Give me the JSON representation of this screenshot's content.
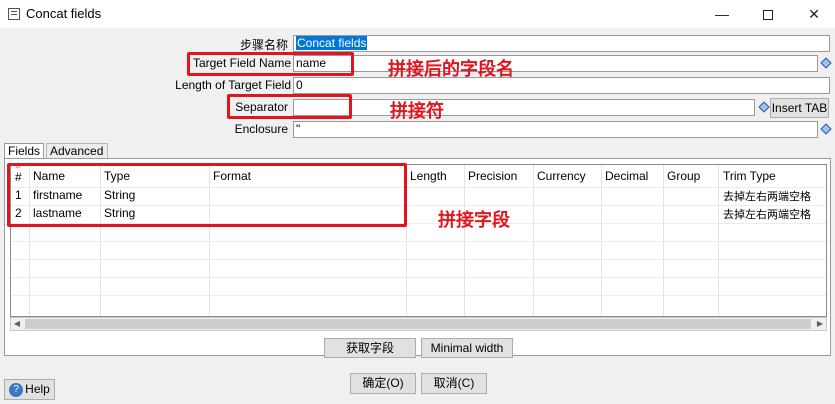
{
  "window": {
    "title": "Concat fields",
    "minimize": "—",
    "close": "✕"
  },
  "form": {
    "step_name_label": "步骤名称",
    "step_name_value": "Concat fields",
    "target_field_label": "Target Field Name",
    "target_field_value": "name",
    "length_label": "Length of Target Field",
    "length_value": "0",
    "separator_label": "Separator",
    "separator_value": "",
    "insert_tab_label": "Insert TAB",
    "enclosure_label": "Enclosure",
    "enclosure_value": "\""
  },
  "annotations": {
    "target_note": "拼接后的字段名",
    "separator_note": "拼接符",
    "fields_note": "拼接字段"
  },
  "tabs": [
    {
      "label": "Fields"
    },
    {
      "label": "Advanced"
    }
  ],
  "table": {
    "columns": [
      "#",
      "Name",
      "Type",
      "Format",
      "Length",
      "Precision",
      "Currency",
      "Decimal",
      "Group",
      "Trim Type"
    ],
    "rows": [
      {
        "num": "1",
        "name": "firstname",
        "type": "String",
        "trim": "去掉左右两端空格"
      },
      {
        "num": "2",
        "name": "lastname",
        "type": "String",
        "trim": "去掉左右两端空格"
      }
    ]
  },
  "buttons": {
    "get_fields": "获取字段",
    "minimal_width": "Minimal width",
    "ok": "确定(O)",
    "cancel": "取消(C)",
    "help": "Help"
  },
  "icons": {
    "app": "dialog-icon",
    "variable": "variable-diamond-icon",
    "help": "help-icon",
    "sort": "sort-up-icon"
  },
  "colors": {
    "annotation": "#e0161e",
    "selection": "#0078d7"
  }
}
